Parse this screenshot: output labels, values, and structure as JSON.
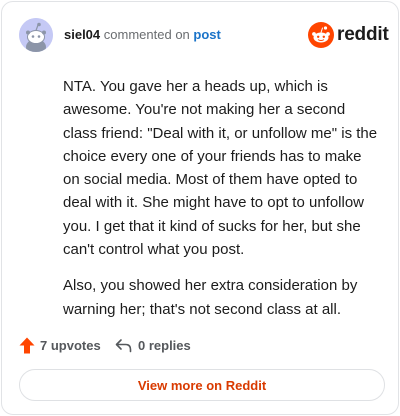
{
  "comment": {
    "username": "siel04",
    "action_text": "commented on",
    "post_link": "post",
    "paragraphs": [
      "NTA. You gave her a heads up, which is awesome. You're not making her a second class friend: \"Deal with it, or unfollow me\" is the choice every one of your friends has to make on social media. Most of them have opted to deal with it. She might have to opt to unfollow you. I get that it kind of sucks for her, but she can't control what you post.",
      "Also, you showed her extra consideration by warning her; that's not second class at all."
    ]
  },
  "brand": {
    "name": "reddit",
    "accent": "#ff4500"
  },
  "stats": {
    "upvotes_label": "7 upvotes",
    "replies_label": "0 replies"
  },
  "cta": {
    "label": "View more on Reddit"
  },
  "icons": {
    "avatar": "snoo-avatar-icon",
    "logo": "reddit-logo-icon",
    "upvote": "upvote-arrow-icon",
    "reply": "reply-arrow-icon"
  },
  "colors": {
    "avatar_bg": "#c5c9f5",
    "link": "#1a73c8",
    "cta_text": "#d93a00",
    "upvote": "#ff4500"
  }
}
